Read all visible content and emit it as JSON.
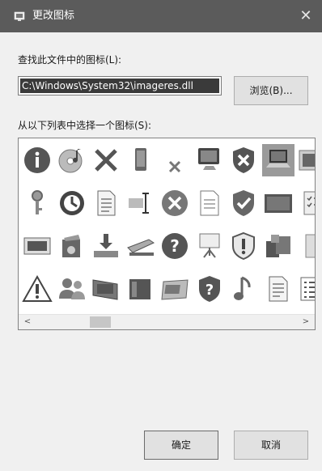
{
  "window": {
    "title": "更改图标",
    "close_glyph": "✕"
  },
  "file_section": {
    "label": "查找此文件中的图标(L):",
    "path_value": "C:\\Windows\\System32\\imageres.dll",
    "browse_label": "浏览(B)..."
  },
  "list_section": {
    "label": "从以下列表中选择一个图标(S):"
  },
  "icons": {
    "rows": [
      [
        "info-icon",
        "media-disc-icon",
        "x-mark-icon",
        "phone-device-icon",
        "small-x-icon",
        "monitor-icon",
        "shield-x-icon",
        "laptop-icon",
        "picture-icon"
      ],
      [
        "key-icon",
        "clock-icon",
        "document-text-icon",
        "rename-cursor-icon",
        "error-icon",
        "document-icon",
        "shield-check-icon",
        "tablet-screen-icon",
        "clipboard-checklist-icon"
      ],
      [
        "photo-image-icon",
        "media-player-icon",
        "drive-install-icon",
        "scanner-icon",
        "help-icon",
        "presentation-icon",
        "shield-warning-icon",
        "programs-icon",
        "image-frame-icon"
      ],
      [
        "warning-triangle-icon",
        "users-icon",
        "film-icon",
        "panel-icon",
        "card-icon",
        "shield-question-icon",
        "music-note-icon",
        "document-lines-icon",
        "list-view-icon"
      ]
    ],
    "selected": "laptop-icon"
  },
  "scrollbar": {
    "left_arrow": "<",
    "right_arrow": ">"
  },
  "buttons": {
    "ok_label": "确定",
    "cancel_label": "取消"
  }
}
